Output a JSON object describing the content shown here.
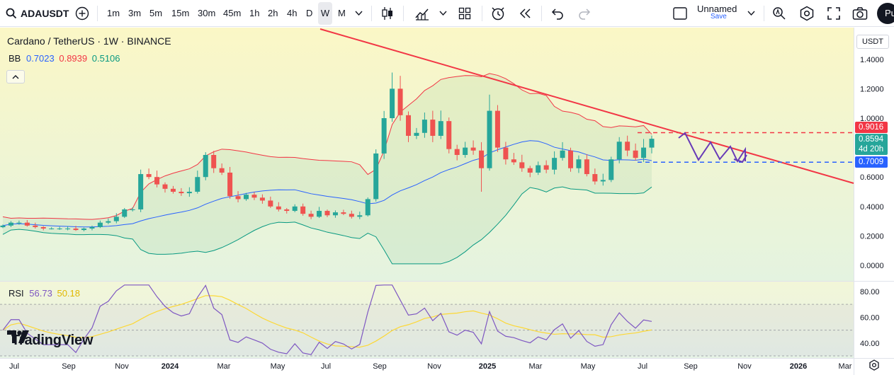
{
  "toolbar": {
    "symbol": "ADAUSDT",
    "timeframes": [
      "1m",
      "3m",
      "5m",
      "15m",
      "30m",
      "45m",
      "1h",
      "2h",
      "4h",
      "D",
      "W",
      "M"
    ],
    "active_timeframe": "W",
    "layout_name": "Unnamed",
    "save_label": "Save",
    "publish_label": "Pu",
    "icons": [
      "search-icon",
      "add-symbol-icon",
      "timeframe-dropdown-icon",
      "candle-style-icon",
      "indicators-icon",
      "templates-icon",
      "alert-icon",
      "replay-icon",
      "undo-icon",
      "redo-icon",
      "layout-icon",
      "quick-search-icon",
      "settings-icon",
      "fullscreen-icon",
      "camera-icon"
    ]
  },
  "legend": {
    "title": "Cardano / TetherUS · 1W · BINANCE",
    "bb_label": "BB",
    "bb_values": [
      "0.7023",
      "0.8939",
      "0.5106"
    ],
    "rsi_label": "RSI",
    "rsi_values": [
      "56.73",
      "50.18"
    ]
  },
  "currency": "USDT",
  "price_axis": {
    "labels": [
      "1.4000",
      "1.2000",
      "1.0000",
      "0.6000",
      "0.4000",
      "0.2000",
      "0.0000"
    ],
    "tags": {
      "upper": "0.9016",
      "current": "0.8594",
      "countdown": "4d 20h",
      "lower": "0.7009"
    }
  },
  "rsi_axis": {
    "labels": [
      "80.00",
      "60.00",
      "40.00"
    ]
  },
  "time_axis": {
    "labels": [
      "Jul",
      "Sep",
      "Nov",
      "2024",
      "Mar",
      "May",
      "Jul",
      "Sep",
      "Nov",
      "2025",
      "Mar",
      "May",
      "Jul",
      "Sep",
      "Nov",
      "2026",
      "Mar"
    ]
  },
  "brand": "TradingView",
  "colors": {
    "up": "#26a69a",
    "down": "#ef5350",
    "bb_basis": "#2962ff",
    "bb_upper": "#f23645",
    "bb_lower": "#089981",
    "rsi": "#7e57c2",
    "rsi_ma": "#fdd835",
    "trendline": "#f23645",
    "projection": "#673ab7"
  },
  "chart_data": {
    "type": "candlestick",
    "interval": "1W",
    "title": "Cardano / TetherUS · 1W · BINANCE",
    "price_range": [
      0.0,
      1.45
    ],
    "last_close": 0.8594,
    "bollinger": {
      "basis": 0.7023,
      "upper": 0.8939,
      "lower": 0.5106
    },
    "levels": {
      "resistance": 0.9016,
      "support": 0.7009
    },
    "rsi": {
      "value": 56.73,
      "ma": 50.18,
      "bands": [
        70,
        30
      ],
      "range": [
        30,
        85
      ]
    },
    "candles_close": [
      0.27,
      0.29,
      0.29,
      0.27,
      0.26,
      0.25,
      0.25,
      0.25,
      0.25,
      0.24,
      0.25,
      0.26,
      0.29,
      0.3,
      0.33,
      0.38,
      0.38,
      0.62,
      0.6,
      0.55,
      0.52,
      0.5,
      0.49,
      0.5,
      0.6,
      0.75,
      0.66,
      0.63,
      0.47,
      0.45,
      0.48,
      0.46,
      0.44,
      0.4,
      0.38,
      0.37,
      0.4,
      0.35,
      0.33,
      0.37,
      0.34,
      0.36,
      0.35,
      0.33,
      0.34,
      0.45,
      0.76,
      1.0,
      1.2,
      1.02,
      0.88,
      0.9,
      0.99,
      0.88,
      0.98,
      0.79,
      0.75,
      0.8,
      0.78,
      0.66,
      1.05,
      0.8,
      0.72,
      0.7,
      0.66,
      0.63,
      0.68,
      0.65,
      0.73,
      0.78,
      0.66,
      0.72,
      0.62,
      0.57,
      0.58,
      0.72,
      0.84,
      0.78,
      0.73,
      0.8,
      0.86
    ]
  }
}
